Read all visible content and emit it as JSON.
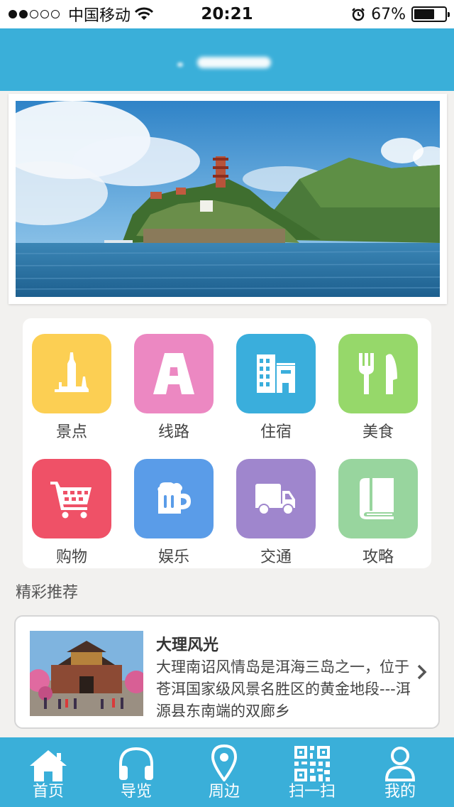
{
  "status_bar": {
    "carrier": "中国移动",
    "time": "20:21",
    "battery": "67%",
    "battery_level": 0.67,
    "signal_bars_filled": 2,
    "signal_bars_total": 5
  },
  "header": {
    "title": ""
  },
  "menu": {
    "items": [
      {
        "label": "景点",
        "icon": "landmark-icon",
        "color": "#fccf53"
      },
      {
        "label": "线路",
        "icon": "road-icon",
        "color": "#ec88c2"
      },
      {
        "label": "住宿",
        "icon": "hotel-icon",
        "color": "#3aaedc"
      },
      {
        "label": "美食",
        "icon": "fork-knife-icon",
        "color": "#96d86a"
      },
      {
        "label": "购物",
        "icon": "cart-icon",
        "color": "#ef5167"
      },
      {
        "label": "娱乐",
        "icon": "beer-icon",
        "color": "#5a9ce8"
      },
      {
        "label": "交通",
        "icon": "truck-icon",
        "color": "#9f86cd"
      },
      {
        "label": "攻略",
        "icon": "book-icon",
        "color": "#98d59e"
      }
    ]
  },
  "recommend": {
    "section_title": "精彩推荐",
    "items": [
      {
        "title": "大理风光",
        "description": "大理南诏风情岛是洱海三岛之一，位于苍洱国家级风景名胜区的黄金地段---洱源县东南端的双廊乡"
      }
    ]
  },
  "tabbar": {
    "items": [
      {
        "label": "首页",
        "icon": "home-icon"
      },
      {
        "label": "导览",
        "icon": "headphones-icon"
      },
      {
        "label": "周边",
        "icon": "location-pin-icon"
      },
      {
        "label": "扫一扫",
        "icon": "qr-code-icon"
      },
      {
        "label": "我的",
        "icon": "user-icon"
      }
    ]
  },
  "colors": {
    "brand": "#3aafd9",
    "background": "#f2f1ef"
  }
}
